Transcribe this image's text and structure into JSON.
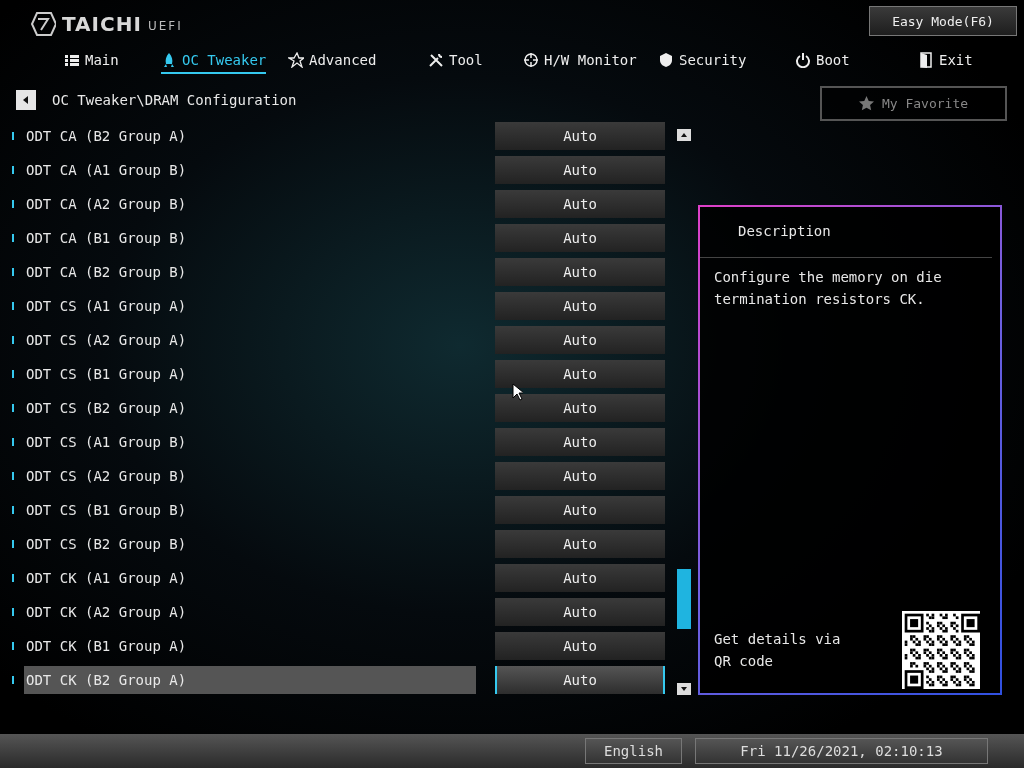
{
  "logo": {
    "brand": "TAICHI",
    "suffix": "UEFI"
  },
  "easy_mode_button": "Easy Mode(F6)",
  "tabs": [
    {
      "label": "Main",
      "selected": false
    },
    {
      "label": "OC Tweaker",
      "selected": true
    },
    {
      "label": "Advanced",
      "selected": false
    },
    {
      "label": "Tool",
      "selected": false
    },
    {
      "label": "H/W Monitor",
      "selected": false
    },
    {
      "label": "Security",
      "selected": false
    },
    {
      "label": "Boot",
      "selected": false
    },
    {
      "label": "Exit",
      "selected": false
    }
  ],
  "breadcrumb": "OC Tweaker\\DRAM Configuration",
  "favorite_button": "My Favorite",
  "settings": [
    {
      "label": "ODT CA (B2 Group A)",
      "value": "Auto",
      "selected": false
    },
    {
      "label": "ODT CA (A1 Group B)",
      "value": "Auto",
      "selected": false
    },
    {
      "label": "ODT CA (A2 Group B)",
      "value": "Auto",
      "selected": false
    },
    {
      "label": "ODT CA (B1 Group B)",
      "value": "Auto",
      "selected": false
    },
    {
      "label": "ODT CA (B2 Group B)",
      "value": "Auto",
      "selected": false
    },
    {
      "label": "ODT CS (A1 Group A)",
      "value": "Auto",
      "selected": false
    },
    {
      "label": "ODT CS (A2 Group A)",
      "value": "Auto",
      "selected": false
    },
    {
      "label": "ODT CS (B1 Group A)",
      "value": "Auto",
      "selected": false
    },
    {
      "label": "ODT CS (B2 Group A)",
      "value": "Auto",
      "selected": false
    },
    {
      "label": "ODT CS (A1 Group B)",
      "value": "Auto",
      "selected": false
    },
    {
      "label": "ODT CS (A2 Group B)",
      "value": "Auto",
      "selected": false
    },
    {
      "label": "ODT CS (B1 Group B)",
      "value": "Auto",
      "selected": false
    },
    {
      "label": "ODT CS (B2 Group B)",
      "value": "Auto",
      "selected": false
    },
    {
      "label": "ODT CK (A1 Group A)",
      "value": "Auto",
      "selected": false
    },
    {
      "label": "ODT CK (A2 Group A)",
      "value": "Auto",
      "selected": false
    },
    {
      "label": "ODT CK (B1 Group A)",
      "value": "Auto",
      "selected": false
    },
    {
      "label": "ODT CK (B2 Group A)",
      "value": "Auto",
      "selected": true
    }
  ],
  "description": {
    "title": "Description",
    "text": "Configure the memory on die termination resistors CK.",
    "qr_text": "Get details via QR code"
  },
  "status_bar": {
    "language": "English",
    "datetime": "Fri 11/26/2021, 02:10:13"
  }
}
